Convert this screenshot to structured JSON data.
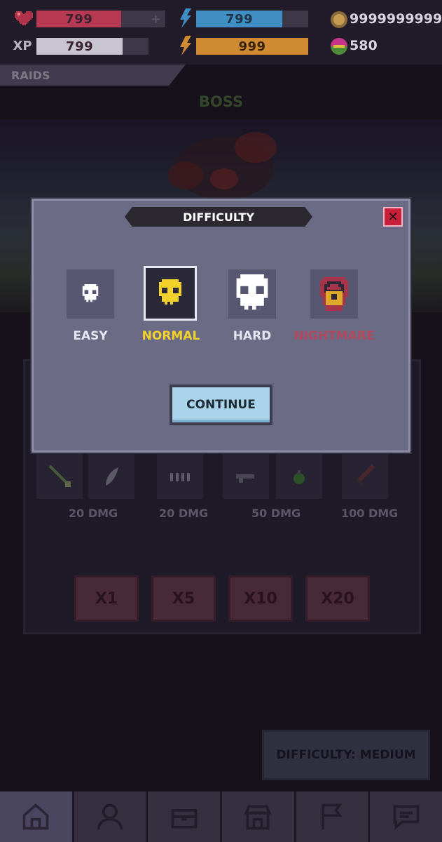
{
  "status": {
    "health": {
      "value": "799",
      "fill": 0.6,
      "color": "#b83a52",
      "icon": "heart-icon"
    },
    "xp": {
      "label": "XP",
      "value": "799",
      "fill": 0.6,
      "color": "#c9c5d0"
    },
    "energy_blue": {
      "value": "799",
      "fill": 0.8,
      "color": "#3f8fc4",
      "icon": "lightning-icon"
    },
    "energy_orange": {
      "value": "999",
      "fill": 1.0,
      "color": "#d08a32",
      "icon": "lightning-icon"
    },
    "coins": {
      "value": "9999999999",
      "icon": "coin-icon"
    },
    "gems": {
      "value": "580",
      "icon": "gem-icon"
    }
  },
  "tab": {
    "label": "RAIDS"
  },
  "scene": {
    "title": "BOSS"
  },
  "weapons": [
    {
      "icon": "staff-icon",
      "dmg": "20 DMG"
    },
    {
      "icon": "feather-icon",
      "dmg": ""
    },
    {
      "icon": "ammo-icon",
      "dmg": "20 DMG"
    },
    {
      "icon": "gun-icon",
      "dmg": "50 DMG"
    },
    {
      "icon": "potion-icon",
      "dmg": ""
    },
    {
      "icon": "sword-icon",
      "dmg": "100 DMG"
    }
  ],
  "multipliers": [
    "X1",
    "X5",
    "X10",
    "X20"
  ],
  "difficulty_button": {
    "label": "DIFFICULTY: MEDIUM"
  },
  "modal": {
    "title": "DIFFICULTY",
    "close": "✕",
    "options": [
      {
        "label": "EASY",
        "color": "#e6e4ee",
        "selected": false,
        "locked": false
      },
      {
        "label": "NORMAL",
        "color": "#f2d22a",
        "selected": true,
        "locked": false
      },
      {
        "label": "HARD",
        "color": "#e6e4ee",
        "selected": false,
        "locked": false
      },
      {
        "label": "NIGHTMARE",
        "color": "#b04a5e",
        "selected": false,
        "locked": true
      }
    ],
    "continue_label": "CONTINUE"
  },
  "nav": [
    {
      "icon": "home-icon",
      "active": true
    },
    {
      "icon": "profile-icon",
      "active": false
    },
    {
      "icon": "chest-icon",
      "active": false
    },
    {
      "icon": "shop-icon",
      "active": false
    },
    {
      "icon": "flag-icon",
      "active": false
    },
    {
      "icon": "chat-icon",
      "active": false
    }
  ]
}
